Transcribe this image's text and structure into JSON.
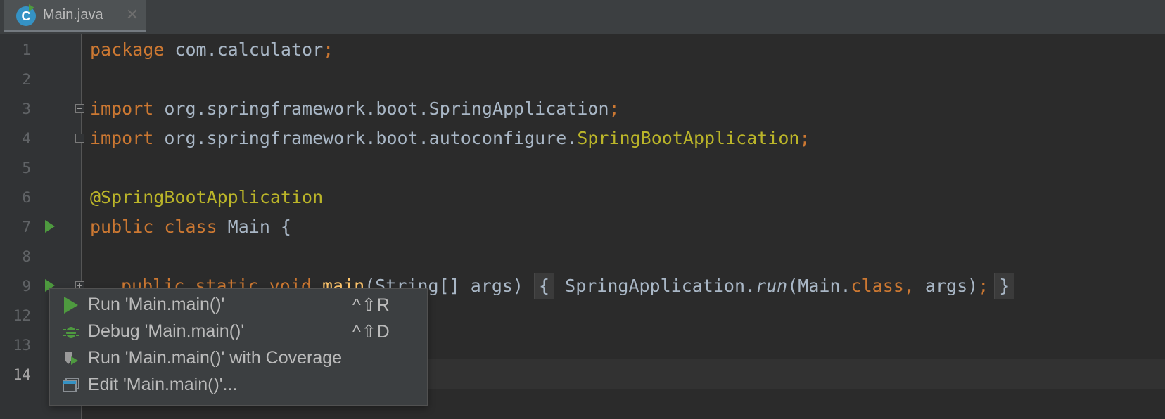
{
  "tab": {
    "label": "Main.java",
    "close": "✕",
    "icon": "java-class-icon"
  },
  "gutter": {
    "lines": [
      "1",
      "2",
      "3",
      "4",
      "5",
      "6",
      "7",
      "8",
      "9",
      "12",
      "13",
      "14"
    ],
    "current_line": "14"
  },
  "code": {
    "l1": {
      "kw": "package",
      "rest": " com.calculator",
      "semi": ";"
    },
    "l3": {
      "kw": "import",
      "rest": " org.springframework.boot.SpringApplication",
      "semi": ";"
    },
    "l4": {
      "kw": "import",
      "rest": " org.springframework.boot.autoconfigure.",
      "ann": "SpringBootApplication",
      "semi": ";"
    },
    "l6": {
      "ann": "@SpringBootApplication"
    },
    "l7": {
      "kw1": "public",
      "kw2": " class",
      "rest": " Main {"
    },
    "l9": {
      "kw1": "public",
      "kw2": " static",
      "kw3": " void",
      "fn": " main",
      "params": "(String[] args) ",
      "open": "{",
      "body1": " SpringApplication.",
      "run": "run",
      "body2": "(Main.",
      "kwclass": "class",
      "comma": ",",
      "body3": " args)",
      "semi": ";",
      "close": "}"
    }
  },
  "popup": {
    "items": [
      {
        "label": "Run 'Main.main()'",
        "shortcut": "^⇧R",
        "icon": "run-icon"
      },
      {
        "label": "Debug 'Main.main()'",
        "shortcut": "^⇧D",
        "icon": "debug-icon"
      },
      {
        "label": "Run 'Main.main()' with Coverage",
        "shortcut": "",
        "icon": "coverage-icon"
      },
      {
        "label": "Edit 'Main.main()'...",
        "shortcut": "",
        "icon": "edit-config-icon"
      }
    ]
  },
  "colors": {
    "background": "#2b2b2b",
    "keyword": "#cc7832",
    "annotation": "#bbb529",
    "text": "#a9b7c6",
    "run_green": "#4e9a3f"
  }
}
